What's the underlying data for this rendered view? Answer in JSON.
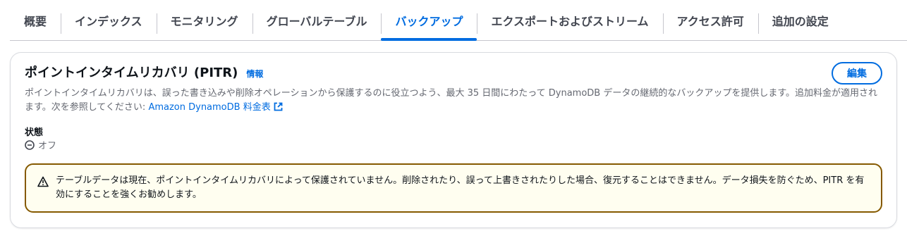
{
  "tabs": [
    {
      "label": "概要"
    },
    {
      "label": "インデックス"
    },
    {
      "label": "モニタリング"
    },
    {
      "label": "グローバルテーブル"
    },
    {
      "label": "バックアップ",
      "active": true
    },
    {
      "label": "エクスポートおよびストリーム"
    },
    {
      "label": "アクセス許可"
    },
    {
      "label": "追加の設定"
    }
  ],
  "panel": {
    "title": "ポイントインタイムリカバリ (PITR)",
    "info_link": "情報",
    "edit_button": "編集",
    "description_text": "ポイントインタイムリカバリは、誤った書き込みや削除オペレーションから保護するのに役立つよう、最大 35 日間にわたって DynamoDB データの継続的なバックアップを提供します。追加料金が適用されます。次を参照してください: ",
    "description_link": "Amazon DynamoDB 料金表",
    "status_label": "状態",
    "status_value": "オフ"
  },
  "alert": {
    "text": "テーブルデータは現在、ポイントインタイムリカバリによって保護されていません。削除されたり、誤って上書きされたりした場合、復元することはできません。データ損失を防ぐため、PITR を有効にすることを強くお勧めします。"
  },
  "colors": {
    "accent": "#006ce0",
    "warning_border": "#855900",
    "warning_bg": "#fffef0"
  }
}
